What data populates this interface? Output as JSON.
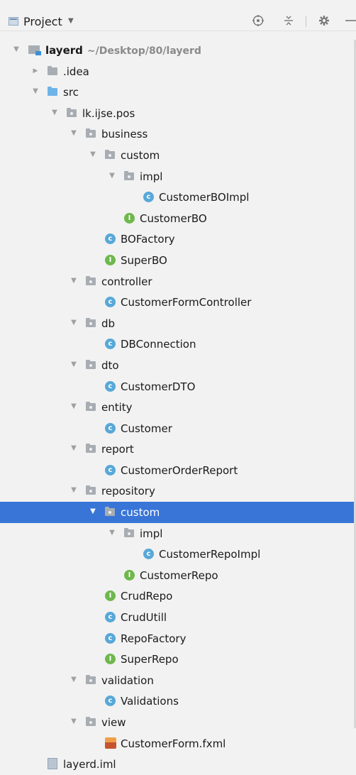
{
  "toolbar": {
    "title": "Project",
    "dropdown_icon": "caret-down",
    "locate_icon": "crosshair",
    "collapse_icon": "collapse-all",
    "settings_icon": "gear",
    "hide_icon": "minus"
  },
  "colors": {
    "selection": "#3875d7",
    "class_icon": "#58a8d8",
    "interface_icon": "#6eb84c",
    "source_folder": "#6fb4e8"
  },
  "tree": [
    {
      "depth": 0,
      "arrow": "expanded",
      "icon": "project-folder",
      "label": "layerd",
      "path": "~/Desktop/80/layerd",
      "bold": true
    },
    {
      "depth": 1,
      "arrow": "collapsed",
      "icon": "folder",
      "label": ".idea"
    },
    {
      "depth": 1,
      "arrow": "expanded",
      "icon": "source-folder",
      "label": "src"
    },
    {
      "depth": 2,
      "arrow": "expanded",
      "icon": "package",
      "label": "lk.ijse.pos"
    },
    {
      "depth": 3,
      "arrow": "expanded",
      "icon": "package",
      "label": "business"
    },
    {
      "depth": 4,
      "arrow": "expanded",
      "icon": "package",
      "label": "custom"
    },
    {
      "depth": 5,
      "arrow": "expanded",
      "icon": "package",
      "label": "impl"
    },
    {
      "depth": 6,
      "arrow": "none",
      "icon": "class",
      "label": "CustomerBOImpl"
    },
    {
      "depth": 5,
      "arrow": "none",
      "icon": "interface",
      "label": "CustomerBO"
    },
    {
      "depth": 4,
      "arrow": "none",
      "icon": "class",
      "label": "BOFactory"
    },
    {
      "depth": 4,
      "arrow": "none",
      "icon": "interface",
      "label": "SuperBO"
    },
    {
      "depth": 3,
      "arrow": "expanded",
      "icon": "package",
      "label": "controller"
    },
    {
      "depth": 4,
      "arrow": "none",
      "icon": "class",
      "label": "CustomerFormController"
    },
    {
      "depth": 3,
      "arrow": "expanded",
      "icon": "package",
      "label": "db"
    },
    {
      "depth": 4,
      "arrow": "none",
      "icon": "class",
      "label": "DBConnection"
    },
    {
      "depth": 3,
      "arrow": "expanded",
      "icon": "package",
      "label": "dto"
    },
    {
      "depth": 4,
      "arrow": "none",
      "icon": "class",
      "label": "CustomerDTO"
    },
    {
      "depth": 3,
      "arrow": "expanded",
      "icon": "package",
      "label": "entity"
    },
    {
      "depth": 4,
      "arrow": "none",
      "icon": "class",
      "label": "Customer"
    },
    {
      "depth": 3,
      "arrow": "expanded",
      "icon": "package",
      "label": "report"
    },
    {
      "depth": 4,
      "arrow": "none",
      "icon": "class",
      "label": "CustomerOrderReport"
    },
    {
      "depth": 3,
      "arrow": "expanded",
      "icon": "package",
      "label": "repository"
    },
    {
      "depth": 4,
      "arrow": "expanded",
      "icon": "package",
      "label": "custom",
      "selected": true
    },
    {
      "depth": 5,
      "arrow": "expanded",
      "icon": "package",
      "label": "impl"
    },
    {
      "depth": 6,
      "arrow": "none",
      "icon": "class",
      "label": "CustomerRepoImpl"
    },
    {
      "depth": 5,
      "arrow": "none",
      "icon": "interface",
      "label": "CustomerRepo"
    },
    {
      "depth": 4,
      "arrow": "none",
      "icon": "interface",
      "label": "CrudRepo"
    },
    {
      "depth": 4,
      "arrow": "none",
      "icon": "class",
      "label": "CrudUtill"
    },
    {
      "depth": 4,
      "arrow": "none",
      "icon": "class",
      "label": "RepoFactory"
    },
    {
      "depth": 4,
      "arrow": "none",
      "icon": "interface",
      "label": "SuperRepo"
    },
    {
      "depth": 3,
      "arrow": "expanded",
      "icon": "package",
      "label": "validation"
    },
    {
      "depth": 4,
      "arrow": "none",
      "icon": "class",
      "label": "Validations"
    },
    {
      "depth": 3,
      "arrow": "expanded",
      "icon": "package",
      "label": "view"
    },
    {
      "depth": 4,
      "arrow": "none",
      "icon": "fxml-file",
      "label": "CustomerForm.fxml"
    },
    {
      "depth": 1,
      "arrow": "none",
      "icon": "iml-file",
      "label": "layerd.iml"
    }
  ]
}
